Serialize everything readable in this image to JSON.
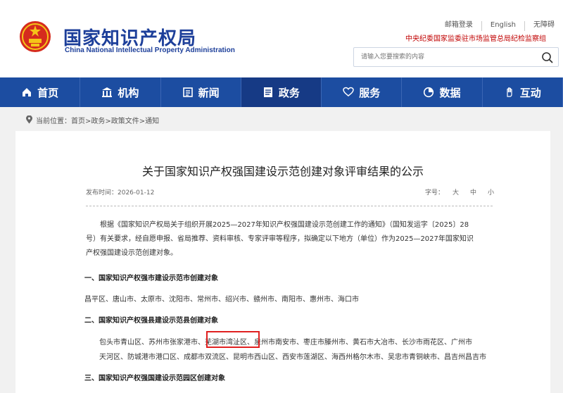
{
  "header": {
    "logo_cn": "国家知识产权局",
    "logo_en": "China National Intellectual Property Administration",
    "links": [
      "邮箱登录",
      "English",
      "无障碍"
    ],
    "discipline": "中央纪委国家监委驻市场监管总局纪检监察组",
    "search_placeholder": "请输入您要搜索的内容"
  },
  "nav": [
    {
      "label": "首页",
      "icon": "home-icon"
    },
    {
      "label": "机构",
      "icon": "building-icon"
    },
    {
      "label": "新闻",
      "icon": "news-icon"
    },
    {
      "label": "政务",
      "icon": "affairs-icon"
    },
    {
      "label": "服务",
      "icon": "heart-hands-icon"
    },
    {
      "label": "数据",
      "icon": "pie-chart-icon"
    },
    {
      "label": "互动",
      "icon": "hand-icon"
    }
  ],
  "active_nav": "政务",
  "breadcrumb": "当前位置：首页>政务>政策文件>通知",
  "article": {
    "title": "关于国家知识产权强国建设示范创建对象评审结果的公示",
    "pubdate": "发布时间：2026-01-12",
    "fontsize_label": "字号：",
    "fontsizes": [
      "大",
      "中",
      "小"
    ],
    "intro_lines": [
      "根据《国家知识产权局关于组织开展2025—2027年知识产权强国建设示范创建工作的通知》（国知发运字〔2025〕28",
      "号）有关要求，经自愿申报、省局推荐、资料审核、专家评审等程序，拟确定以下地方（单位）作为2025—2027年国家知识",
      "产权强国建设示范创建对象。"
    ],
    "section1": "一、国家知识产权强市建设示范市创建对象",
    "cities1": "昌平区、唐山市、太原市、沈阳市、常州市、绍兴市、赣州市、南阳市、惠州市、海口市",
    "section2": "二、国家知识产权强县建设示范县创建对象",
    "cities2_line1": "包头市青山区、苏州市张家港市、芜湖市湾沚区、泉州市南安市、枣庄市滕州市、黄石市大冶市、长沙市雨花区、广州市",
    "cities2_line2": "天河区、防城港市港口区、成都市双流区、昆明市西山区、西安市莲湖区、海西州格尔木市、吴忠市青铜峡市、昌吉州昌吉市",
    "section3": "三、国家知识产权强国建设示范园区创建对象"
  },
  "colors": {
    "brand": "#1c4da1",
    "nav_active": "#163a85",
    "highlight": "#e02020",
    "discipline": "#c00000"
  }
}
